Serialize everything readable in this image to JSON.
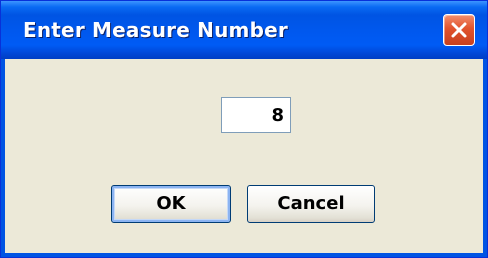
{
  "window": {
    "title": "Enter Measure Number"
  },
  "input": {
    "value": "8"
  },
  "buttons": {
    "ok_label": "OK",
    "cancel_label": "Cancel"
  },
  "colors": {
    "titlebar": "#0054e3",
    "client_background": "#ece9d8",
    "close_button": "#e1532d"
  },
  "icons": {
    "close": "close-icon"
  }
}
